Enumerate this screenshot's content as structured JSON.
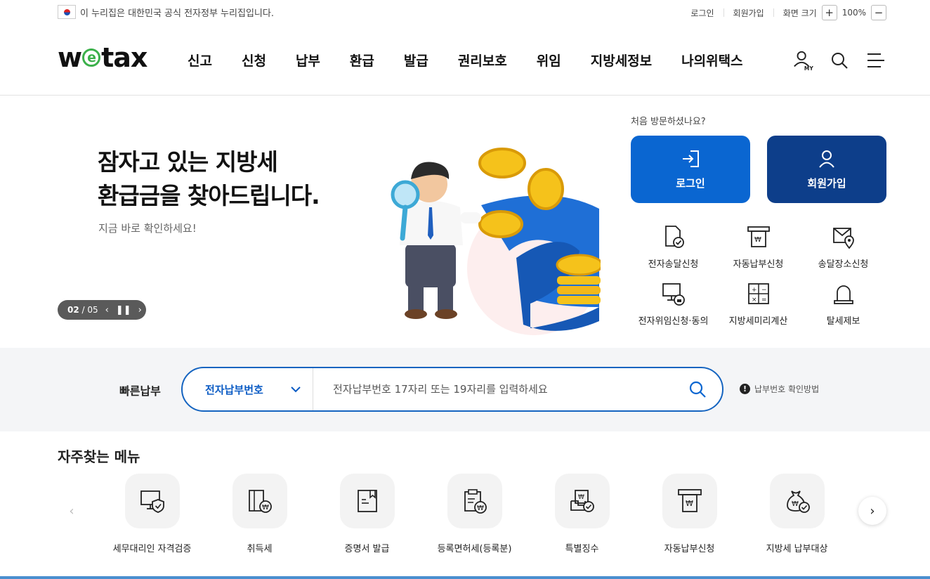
{
  "util": {
    "gov_notice": "이 누리집은 대한민국 공식 전자정부 누리집입니다.",
    "login": "로그인",
    "join": "회원가입",
    "screen_size": "화면 크기",
    "zoom_in": "+",
    "zoom_level": "100%",
    "zoom_out": "−"
  },
  "header": {
    "logo_w": "w",
    "logo_e": "e",
    "logo_tax": "tax",
    "my_label": "MY",
    "nav": [
      "신고",
      "신청",
      "납부",
      "환급",
      "발급",
      "권리보호",
      "위임",
      "지방세정보",
      "나의위택스"
    ]
  },
  "hero": {
    "title_line1": "잠자고 있는 지방세",
    "title_line2": "환급금을 찾아드립니다.",
    "subtitle": "지금 바로 확인하세요!",
    "pager_current": "02",
    "pager_total": "/ 05",
    "pager_prev": "‹",
    "pager_pause": "❚❚",
    "pager_next": "›"
  },
  "side": {
    "visit_question": "처음 방문하셨나요?",
    "login_button": "로그인",
    "join_button": "회원가입",
    "quick_items": [
      {
        "label": "전자송달신청",
        "icon": "document-check-icon"
      },
      {
        "label": "자동납부신청",
        "icon": "atm-won-icon"
      },
      {
        "label": "송달장소신청",
        "icon": "envelope-location-icon"
      },
      {
        "label": "전자위임신청·동의",
        "icon": "monitor-lock-icon"
      },
      {
        "label": "지방세미리계산",
        "icon": "calculator-icon"
      },
      {
        "label": "탈세제보",
        "icon": "siren-icon"
      }
    ]
  },
  "quickpay": {
    "label": "빠른납부",
    "select_value": "전자납부번호",
    "placeholder": "전자납부번호 17자리 또는 19자리를 입력하세요",
    "help": "납부번호 확인방법",
    "help_mark": "!"
  },
  "frequent": {
    "title": "자주찾는 메뉴",
    "prev": "‹",
    "next": "›",
    "items": [
      {
        "label": "세무대리인 자격검증",
        "icon": "monitor-shield-icon"
      },
      {
        "label": "취득세",
        "icon": "book-won-icon"
      },
      {
        "label": "증명서 발급",
        "icon": "certificate-icon"
      },
      {
        "label": "등록면허세(등록분)",
        "icon": "clipboard-won-icon"
      },
      {
        "label": "특별징수",
        "icon": "tray-won-check-icon"
      },
      {
        "label": "자동납부신청",
        "icon": "atm-won-icon"
      },
      {
        "label": "지방세 납부대상",
        "icon": "moneybag-check-icon"
      }
    ]
  }
}
